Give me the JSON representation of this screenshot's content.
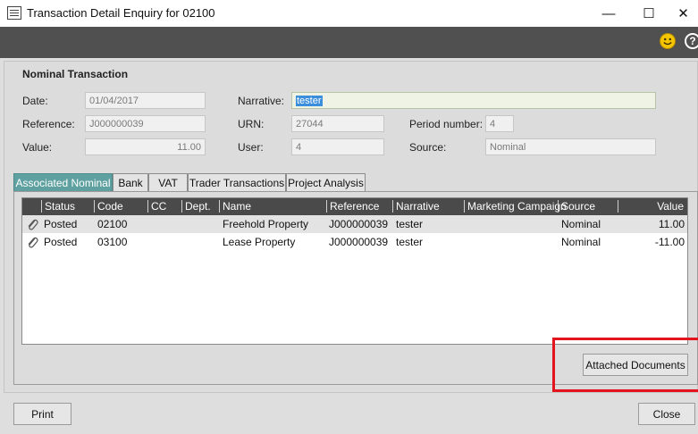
{
  "window": {
    "title": "Transaction Detail Enquiry for 02100",
    "minimize": "—",
    "maximize": "☐",
    "close": "✕"
  },
  "toolbar": {
    "help": "?"
  },
  "section": {
    "title": "Nominal Transaction"
  },
  "form": {
    "date_label": "Date:",
    "date_value": "01/04/2017",
    "reference_label": "Reference:",
    "reference_value": "J000000039",
    "value_label": "Value:",
    "value_value": "11.00",
    "narrative_label": "Narrative:",
    "narrative_value": "tester",
    "urn_label": "URN:",
    "urn_value": "27044",
    "user_label": "User:",
    "user_value": "4",
    "period_label": "Period number:",
    "period_value": "4",
    "source_label": "Source:",
    "source_value": "Nominal"
  },
  "tabs": [
    {
      "label": "Associated Nominal",
      "active": true
    },
    {
      "label": "Bank"
    },
    {
      "label": "VAT"
    },
    {
      "label": "Trader Transactions"
    },
    {
      "label": "Project Analysis"
    }
  ],
  "grid": {
    "columns": [
      "Status",
      "Code",
      "CC",
      "Dept.",
      "Name",
      "Reference",
      "Narrative",
      "Marketing Campaign",
      "Source",
      "Value"
    ],
    "rows": [
      {
        "status": "Posted",
        "code": "02100",
        "cc": "",
        "dept": "",
        "name": "Freehold Property",
        "reference": "J000000039",
        "narrative": "tester",
        "campaign": "",
        "source": "Nominal",
        "value": "11.00"
      },
      {
        "status": "Posted",
        "code": "03100",
        "cc": "",
        "dept": "",
        "name": "Lease Property",
        "reference": "J000000039",
        "narrative": "tester",
        "campaign": "",
        "source": "Nominal",
        "value": "-11.00"
      }
    ]
  },
  "buttons": {
    "attached_documents": "Attached Documents",
    "print": "Print",
    "close": "Close"
  },
  "colors": {
    "active_tab": "#5fa0a0",
    "toolbar": "#505050",
    "highlight": "#e4141e",
    "selection": "#3b8edb"
  }
}
